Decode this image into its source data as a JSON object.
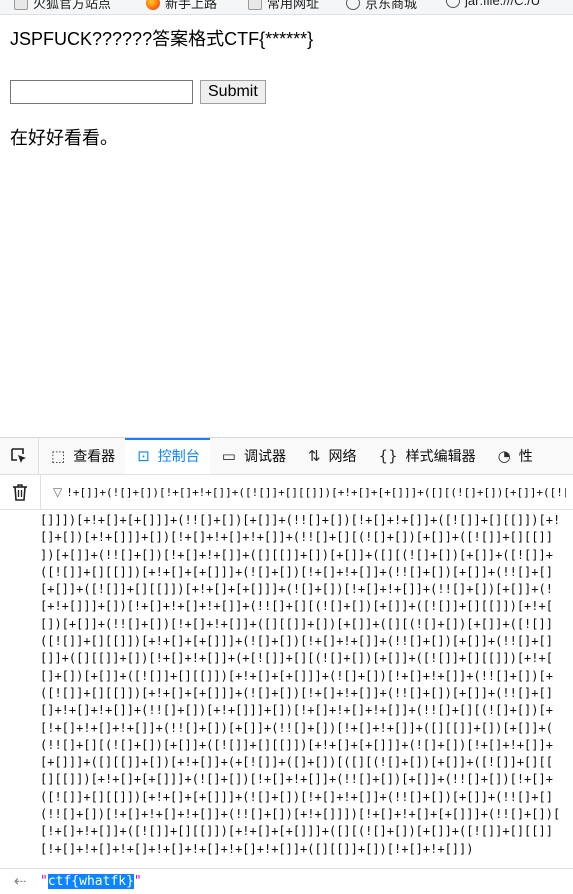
{
  "bookmarks": [
    {
      "label": "火狐官方站点",
      "icon": "folder-icon"
    },
    {
      "label": "新手上路",
      "icon": "firefox-icon"
    },
    {
      "label": "常用网址",
      "icon": "folder-icon"
    },
    {
      "label": "京东商城",
      "icon": "globe-icon"
    },
    {
      "label": "jar:file:///C:/U",
      "icon": "globe-icon"
    }
  ],
  "page": {
    "heading": "JSPFUCK??????答案格式CTF{******}",
    "input_value": "",
    "submit_label": "Submit",
    "hint": "在好好看看。"
  },
  "devtools": {
    "tabs": [
      {
        "label": "查看器",
        "icon": "inspector-icon",
        "active": false
      },
      {
        "label": "控制台",
        "icon": "console-icon",
        "active": true
      },
      {
        "label": "调试器",
        "icon": "debugger-icon",
        "active": false
      },
      {
        "label": "网络",
        "icon": "network-icon",
        "active": false
      },
      {
        "label": "样式编辑器",
        "icon": "style-editor-icon",
        "active": false
      },
      {
        "label": "性",
        "icon": "performance-icon",
        "active": false
      }
    ],
    "filter_text": "!+[]]+(![]+[])[!+[]+!+[]]+([![]]+[][[]])[+!+[]+[+[]]]+([][(![]+[])[+[]]+([![]]+[][[]])[+!+[]+[+[]]]+(![]+[])[!+[]+!+[]]+(!![]+[])[+[]]",
    "code_lines": [
      "[]]])[+!+[]+[+[]]]+(!![]+[])[+[]]+(!![]+[])[!+[]+!+[]]+([![]]+[][[]])[+!",
      "[]+[])[+!+[]]]+[])[!+[]+!+[]+!+[]]+(!![]+[][(![]+[])[+[]]+([![]]+[][[]]",
      "])[+[]]+(!![]+[])[!+[]+!+[]]+([][[]]+[])[+[]]+([][(![]+[])[+[]]+([![]]+",
      "([![]]+[][[]])[+!+[]+[+[]]]+(![]+[])[!+[]+!+[]]+(!![]+[])[+[]]+(!![]+[]",
      "[+[]]+([![]]+[][[]])[+!+[]+[+[]]]+(![]+[])[!+[]+!+[]]+(!![]+[])[+[]]+(!",
      "[+!+[]]]+[])[!+[]+!+[]+!+[]]+(!![]+[][(![]+[])[+[]]+([![]]+[][[]])[+!+[",
      "[])[+[]]+(!![]+[])[!+[]+!+[]]+([][[]]+[])[+[]]+([][(![]+[])[+[]]+([![]]",
      "([![]]+[][[]])[+!+[]+[+[]]]+(![]+[])[!+[]+!+[]]+(!![]+[])[+[]]+(!![]+[]",
      "[]]+([][[]]+[])[!+[]+!+[]]+(+[![]]+[][(![]+[])[+[]]+([![]]+[][[]])[+!+[",
      "[]+[])[+[]]+([![]]+[][[]])[+!+[]+[+[]]]+(![]+[])[!+[]+!+[]]+(!![]+[])[+",
      "([![]]+[][[]])[+!+[]+[+[]]]+(![]+[])[!+[]+!+[]]+(!![]+[])[+[]]+(!![]+[]",
      "[]+!+[]+!+[]]+(!![]+[])[+!+[]]]+[])[!+[]+!+[]+!+[]]+(!![]+[][(![]+[])[+",
      "[!+[]+!+[]+!+[]]+(!![]+[])[+[]]+(!![]+[])[!+[]+!+[]]+([][[]]+[])[+[]]+(",
      "(!![]+[][(![]+[])[+[]]+([![]]+[][[]])[+!+[]+[+[]]]+(![]+[])[!+[]+!+[]]+",
      "[+[]]]+([][[]]+[])[+!+[]]+(+[![]]+([]+[])[([][(![]+[])[+[]]+([![]]+[][[",
      "[][[]])[+!+[]+[+[]]]+(![]+[])[!+[]+!+[]]+(!![]+[])[+[]]+(!![]+[])[!+[]+",
      "([![]]+[][[]])[+!+[]+[+[]]]+(![]+[])[!+[]+!+[]]+(!![]+[])[+[]]+(!![]+[]",
      "(!![]+[])[!+[]+!+[]+!+[]]+(!![]+[])[+!+[]]])[!+[]+!+[]+[+[]]]+(!![]+[])[",
      "[!+[]+!+[]]+([![]]+[][[]])[+!+[]+[+[]]]+([][(![]+[])[+[]]+([![]]+[][[]]",
      "[!+[]+!+[]+!+[]+!+[]+!+[]+!+[]+!+[]]+([][[]]+[])[!+[]+!+[]])"
    ],
    "result_prefix": "\"",
    "result_value": "ctf{whatfk}",
    "result_suffix": "\""
  }
}
